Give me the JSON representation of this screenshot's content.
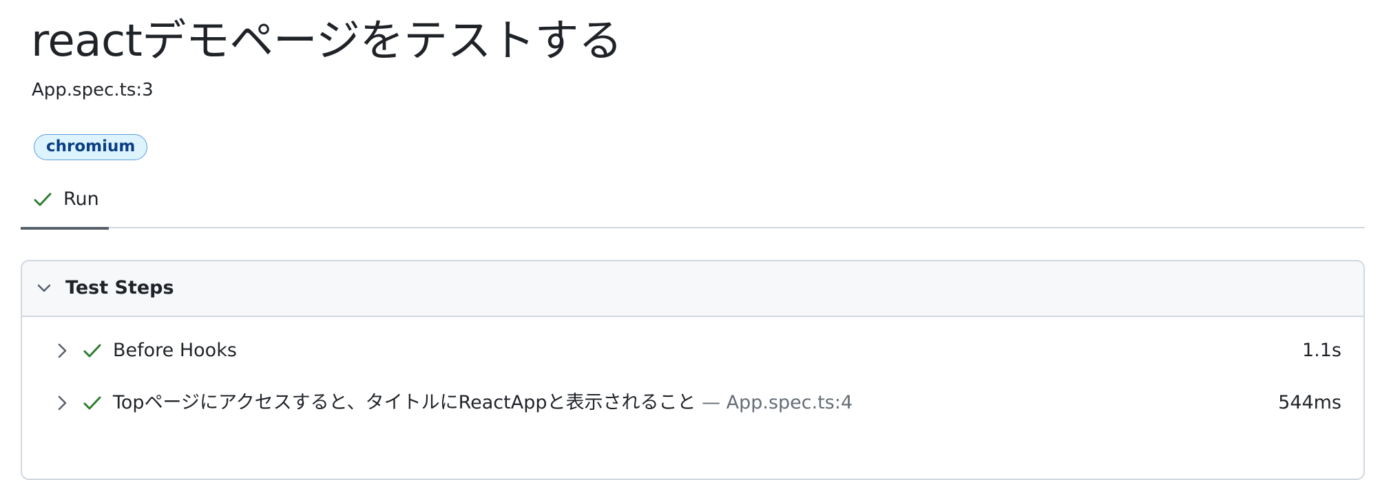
{
  "test": {
    "title": "reactデモページをテストする",
    "location": "App.spec.ts:3",
    "project": "chromium"
  },
  "tabs": [
    {
      "label": "Run",
      "status": "passed",
      "icon": "check-icon"
    }
  ],
  "steps_section": {
    "title": "Test Steps",
    "expanded": true,
    "icon": "chevron-down-icon"
  },
  "steps": [
    {
      "title": "Before Hooks",
      "location": "",
      "duration": "1.1s",
      "status": "passed"
    },
    {
      "title": "Topページにアクセスすると、タイトルにReactAppと表示されること",
      "location": " — App.spec.ts:4",
      "duration": "544ms",
      "status": "passed"
    }
  ],
  "colors": {
    "success": "#2f7d32",
    "badge_bg": "#ddf4ff",
    "badge_border": "#5a9be0",
    "badge_text": "#0a3d84",
    "border": "#d0d7de",
    "muted_text": "#656d76"
  }
}
